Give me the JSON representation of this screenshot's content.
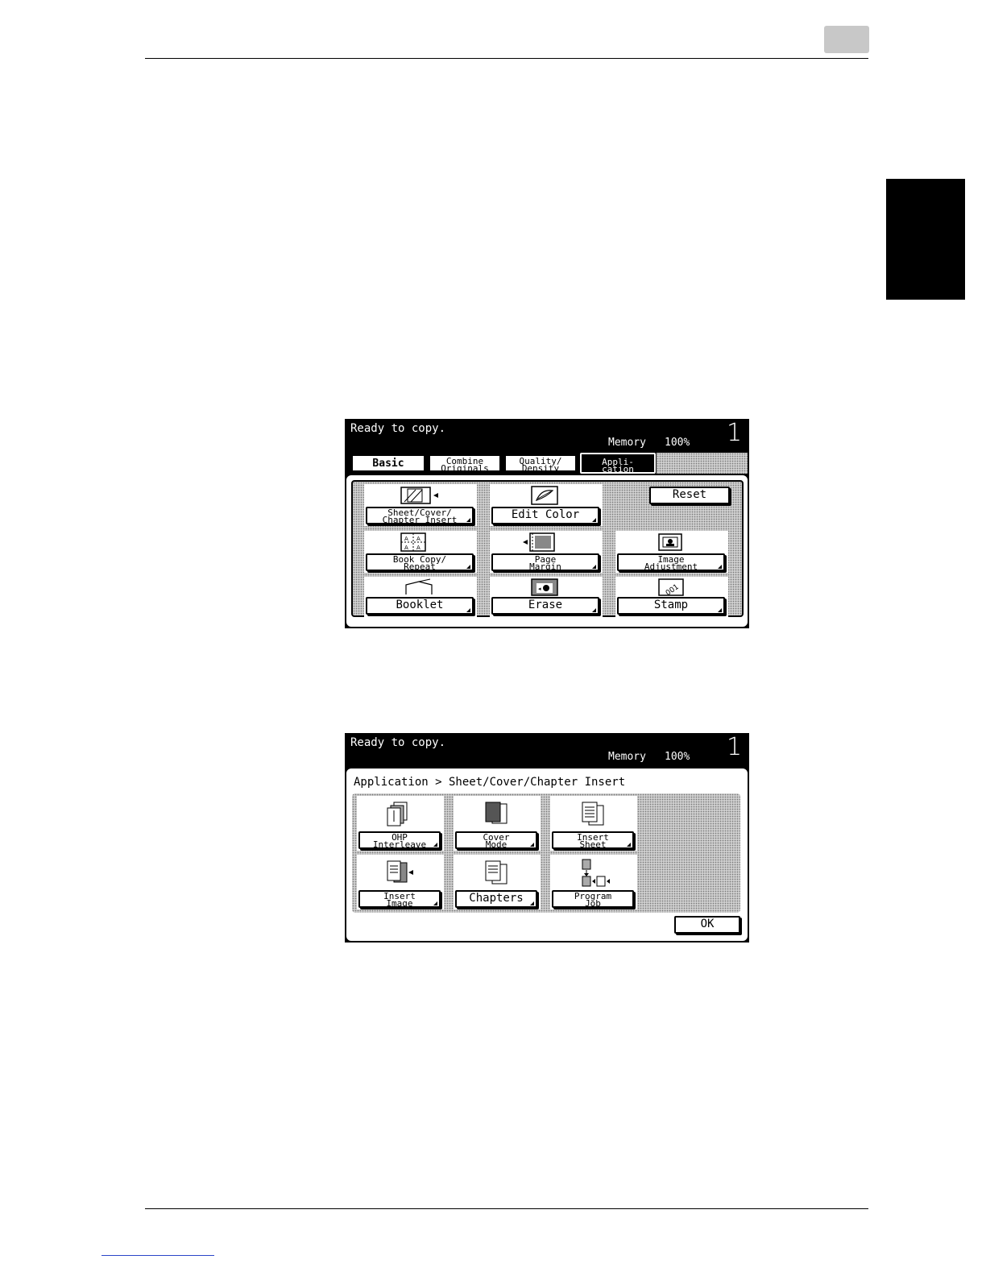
{
  "screen1": {
    "status": "Ready to copy.",
    "memory_label": "Memory",
    "memory_value": "100%",
    "copies": "1",
    "tabs": [
      {
        "label1": "Basic",
        "label2": ""
      },
      {
        "label1": "Combine",
        "label2": "Originals"
      },
      {
        "label1": "Quality/",
        "label2": "Density"
      },
      {
        "label1": "Appli-",
        "label2": "cation"
      }
    ],
    "buttons": {
      "sheet_cover": {
        "l1": "Sheet/Cover/",
        "l2": "Chapter Insert"
      },
      "edit_color": "Edit Color",
      "reset": "Reset",
      "book_copy": {
        "l1": "Book Copy/",
        "l2": "Repeat"
      },
      "page_margin": {
        "l1": "Page",
        "l2": "Margin"
      },
      "image_adjust": {
        "l1": "Image",
        "l2": "Adjustment"
      },
      "booklet": "Booklet",
      "erase": "Erase",
      "stamp": "Stamp"
    },
    "icons": {
      "sheet_cover": "sheet-insert-icon",
      "edit_color": "color-icon",
      "book_copy": "book-repeat-icon",
      "page_margin": "page-margin-icon",
      "image_adjust": "image-adjust-icon",
      "booklet": "booklet-icon",
      "erase": "erase-icon",
      "stamp": "stamp-icon"
    }
  },
  "screen2": {
    "status": "Ready to copy.",
    "memory_label": "Memory",
    "memory_value": "100%",
    "copies": "1",
    "breadcrumb": "Application > Sheet/Cover/Chapter Insert",
    "buttons": {
      "ohp": {
        "l1": "OHP",
        "l2": "Interleave"
      },
      "cover_mode": {
        "l1": "Cover",
        "l2": "Mode"
      },
      "insert_sheet": {
        "l1": "Insert",
        "l2": "Sheet"
      },
      "insert_image": {
        "l1": "Insert",
        "l2": "Image"
      },
      "chapters": "Chapters",
      "program_job": {
        "l1": "Program",
        "l2": "Job"
      },
      "ok": "OK"
    },
    "icons": {
      "ohp": "ohp-interleave-icon",
      "cover_mode": "cover-mode-icon",
      "insert_sheet": "insert-sheet-icon",
      "insert_image": "insert-image-icon",
      "chapters": "chapters-icon",
      "program_job": "program-job-icon"
    }
  }
}
